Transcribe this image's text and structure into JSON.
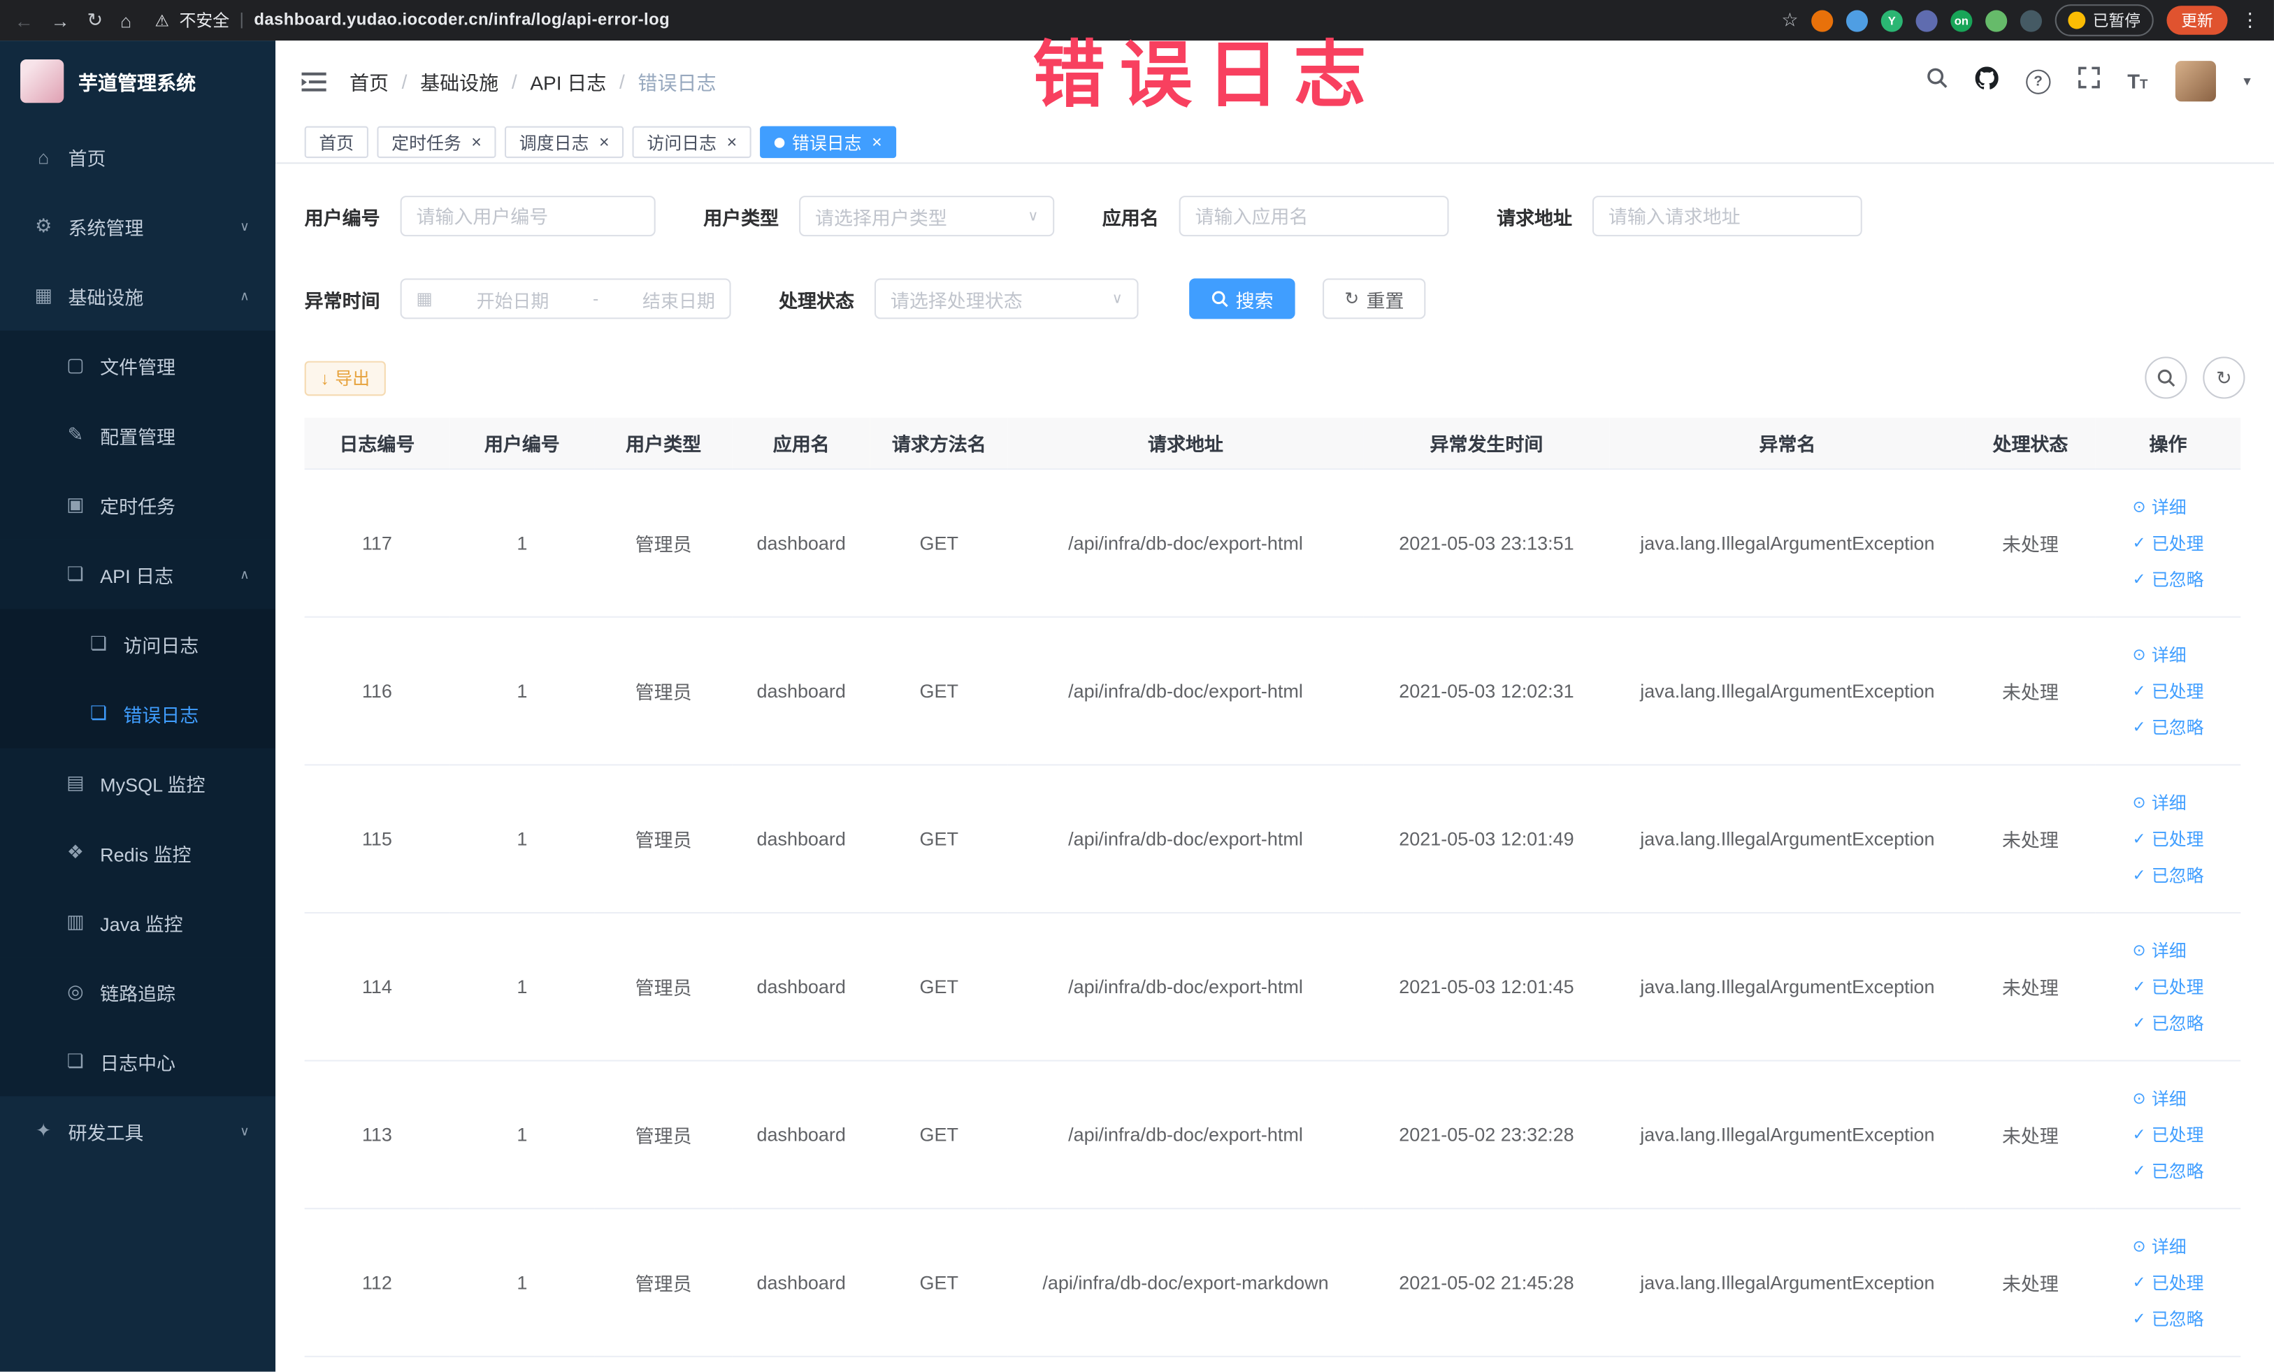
{
  "annotation": {
    "text": "错误日志"
  },
  "colors": {
    "accent": "#409eff",
    "warning": "#e6a23c",
    "annotation": "#f8405f",
    "update": "#e0532f"
  },
  "browser": {
    "security_label": "不安全",
    "url": "dashboard.yudao.iocoder.cn/infra/log/api-error-log",
    "paused_badge": "已暂停",
    "update_button": "更新",
    "extensions": [
      {
        "name": "extension-orange",
        "color": "#e8710a",
        "label": ""
      },
      {
        "name": "extension-blue",
        "color": "#4f9ee3",
        "label": ""
      },
      {
        "name": "extension-green-y",
        "color": "#2bb673",
        "label": "Y"
      },
      {
        "name": "extension-indigo",
        "color": "#5f6caf",
        "label": ""
      },
      {
        "name": "extension-on-badge",
        "color": "#18a558",
        "label": "on"
      },
      {
        "name": "extension-leaf",
        "color": "#66bb6a",
        "label": ""
      },
      {
        "name": "extension-dark",
        "color": "#455a64",
        "label": ""
      }
    ]
  },
  "sidebar": {
    "logo_title": "芋道管理系统",
    "menu": [
      {
        "name": "home",
        "label": "首页",
        "icon": "home-icon",
        "level": 1
      },
      {
        "name": "system",
        "label": "系统管理",
        "icon": "gear-icon",
        "level": 1,
        "chevron": "down"
      },
      {
        "name": "infra",
        "label": "基础设施",
        "icon": "infra-icon",
        "level": 1,
        "chevron": "up",
        "open": true
      },
      {
        "name": "file-manage",
        "label": "文件管理",
        "icon": "file-icon",
        "level": 2
      },
      {
        "name": "config-manage",
        "label": "配置管理",
        "icon": "config-icon",
        "level": 2
      },
      {
        "name": "scheduled-job",
        "label": "定时任务",
        "icon": "job-icon",
        "level": 2
      },
      {
        "name": "api-log",
        "label": "API 日志",
        "icon": "api-log-icon",
        "level": 2,
        "chevron": "up",
        "open": true
      },
      {
        "name": "access-log",
        "label": "访问日志",
        "icon": "access-log-icon",
        "level": 3
      },
      {
        "name": "error-log",
        "label": "错误日志",
        "icon": "error-log-icon",
        "level": 3,
        "active": true
      },
      {
        "name": "mysql-monitor",
        "label": "MySQL 监控",
        "icon": "mysql-icon",
        "level": 2
      },
      {
        "name": "redis-monitor",
        "label": "Redis 监控",
        "icon": "redis-icon",
        "level": 2
      },
      {
        "name": "java-monitor",
        "label": "Java 监控",
        "icon": "java-icon",
        "level": 2
      },
      {
        "name": "trace",
        "label": "链路追踪",
        "icon": "trace-icon",
        "level": 2
      },
      {
        "name": "log-center",
        "label": "日志中心",
        "icon": "log-center-icon",
        "level": 2
      },
      {
        "name": "dev-tools",
        "label": "研发工具",
        "icon": "tools-icon",
        "level": 1,
        "chevron": "down"
      }
    ]
  },
  "header": {
    "breadcrumb": [
      "首页",
      "基础设施",
      "API 日志",
      "错误日志"
    ]
  },
  "tabs": [
    {
      "label": "首页",
      "closable": false,
      "active": false
    },
    {
      "label": "定时任务",
      "closable": true,
      "active": false
    },
    {
      "label": "调度日志",
      "closable": true,
      "active": false
    },
    {
      "label": "访问日志",
      "closable": true,
      "active": false
    },
    {
      "label": "错误日志",
      "closable": true,
      "active": true
    }
  ],
  "filters": {
    "user_id": {
      "label": "用户编号",
      "placeholder": "请输入用户编号"
    },
    "user_type": {
      "label": "用户类型",
      "placeholder": "请选择用户类型"
    },
    "app_name": {
      "label": "应用名",
      "placeholder": "请输入应用名"
    },
    "request_url": {
      "label": "请求地址",
      "placeholder": "请输入请求地址"
    },
    "exception_time": {
      "label": "异常时间",
      "start_placeholder": "开始日期",
      "separator": "-",
      "end_placeholder": "结束日期"
    },
    "process_status": {
      "label": "处理状态",
      "placeholder": "请选择处理状态"
    },
    "search_button": "搜索",
    "reset_button": "重置"
  },
  "toolbar": {
    "export_button": "导出"
  },
  "table": {
    "columns": [
      "日志编号",
      "用户编号",
      "用户类型",
      "应用名",
      "请求方法名",
      "请求地址",
      "异常发生时间",
      "异常名",
      "处理状态",
      "操作"
    ],
    "action_labels": [
      "详细",
      "已处理",
      "已忽略"
    ],
    "rows": [
      {
        "log_id": "117",
        "user_id": "1",
        "user_type": "管理员",
        "app_name": "dashboard",
        "method": "GET",
        "request_url": "/api/infra/db-doc/export-html",
        "time": "2021-05-03 23:13:51",
        "exception": "java.lang.IllegalArgumentException",
        "status": "未处理"
      },
      {
        "log_id": "116",
        "user_id": "1",
        "user_type": "管理员",
        "app_name": "dashboard",
        "method": "GET",
        "request_url": "/api/infra/db-doc/export-html",
        "time": "2021-05-03 12:02:31",
        "exception": "java.lang.IllegalArgumentException",
        "status": "未处理"
      },
      {
        "log_id": "115",
        "user_id": "1",
        "user_type": "管理员",
        "app_name": "dashboard",
        "method": "GET",
        "request_url": "/api/infra/db-doc/export-html",
        "time": "2021-05-03 12:01:49",
        "exception": "java.lang.IllegalArgumentException",
        "status": "未处理"
      },
      {
        "log_id": "114",
        "user_id": "1",
        "user_type": "管理员",
        "app_name": "dashboard",
        "method": "GET",
        "request_url": "/api/infra/db-doc/export-html",
        "time": "2021-05-03 12:01:45",
        "exception": "java.lang.IllegalArgumentException",
        "status": "未处理"
      },
      {
        "log_id": "113",
        "user_id": "1",
        "user_type": "管理员",
        "app_name": "dashboard",
        "method": "GET",
        "request_url": "/api/infra/db-doc/export-html",
        "time": "2021-05-02 23:32:28",
        "exception": "java.lang.IllegalArgumentException",
        "status": "未处理"
      },
      {
        "log_id": "112",
        "user_id": "1",
        "user_type": "管理员",
        "app_name": "dashboard",
        "method": "GET",
        "request_url": "/api/infra/db-doc/export-markdown",
        "time": "2021-05-02 21:45:28",
        "exception": "java.lang.IllegalArgumentException",
        "status": "未处理"
      }
    ]
  }
}
